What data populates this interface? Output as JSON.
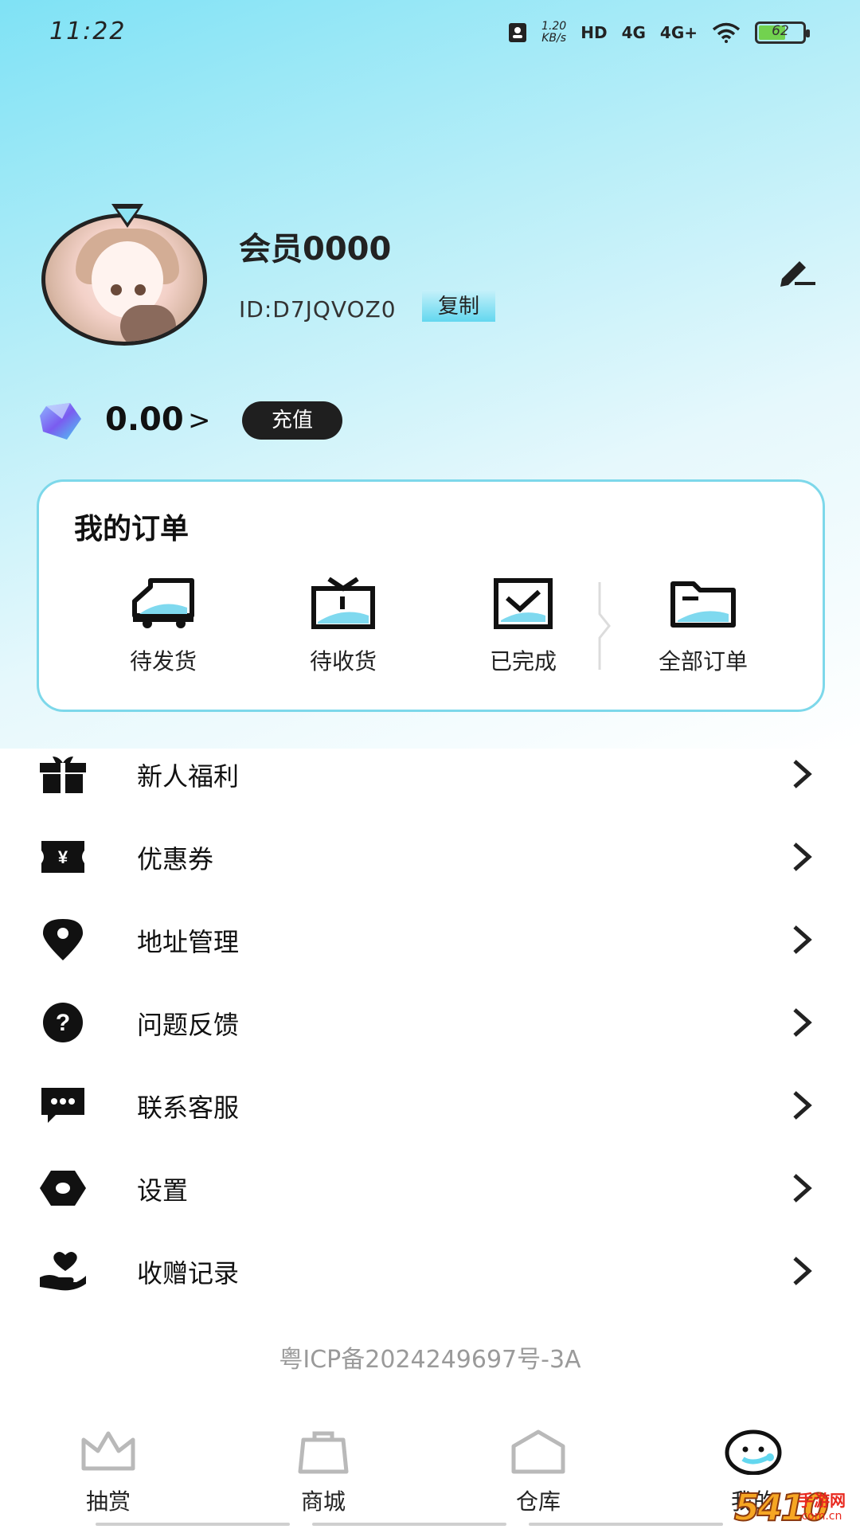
{
  "status_bar": {
    "time": "11:22",
    "speed_value": "1.20",
    "speed_unit": "KB/s",
    "hd_label": "HD",
    "sim1_label": "4G",
    "sim2_label": "4G+",
    "battery_level": "62"
  },
  "profile": {
    "username": "会员0000",
    "user_id": "ID:D7JQVOZ0",
    "copy_label": "复制",
    "balance": "0.00",
    "balance_arrow": ">",
    "recharge_label": "充值"
  },
  "orders": {
    "title": "我的订单",
    "items": [
      {
        "label": "待发货",
        "icon": "truck-icon"
      },
      {
        "label": "待收货",
        "icon": "tv-box-icon"
      },
      {
        "label": "已完成",
        "icon": "check-box-icon"
      },
      {
        "label": "全部订单",
        "icon": "folder-icon"
      }
    ]
  },
  "menu": [
    {
      "label": "新人福利",
      "icon": "gift-icon"
    },
    {
      "label": "优惠券",
      "icon": "coupon-icon"
    },
    {
      "label": "地址管理",
      "icon": "location-pin-icon"
    },
    {
      "label": "问题反馈",
      "icon": "question-icon"
    },
    {
      "label": "联系客服",
      "icon": "chat-bubble-icon"
    },
    {
      "label": "设置",
      "icon": "hexagon-settings-icon"
    },
    {
      "label": "收赠记录",
      "icon": "heart-hand-icon"
    }
  ],
  "footer": {
    "icp": "粤ICP备2024249697号-3A"
  },
  "bottom_nav": [
    {
      "label": "抽赏",
      "icon": "crown-icon",
      "active": false
    },
    {
      "label": "商城",
      "icon": "shopping-bag-icon",
      "active": false
    },
    {
      "label": "仓库",
      "icon": "warehouse-icon",
      "active": false
    },
    {
      "label": "我的",
      "icon": "smiley-face-icon",
      "active": true
    }
  ],
  "watermark": {
    "number": "5410",
    "text": "手游网",
    "url": ".com.cn"
  },
  "colors": {
    "accent": "#63d7ef",
    "card_border": "#7dd8ea",
    "dark": "#1f1f1f",
    "icp_text": "#9a9a9a"
  }
}
